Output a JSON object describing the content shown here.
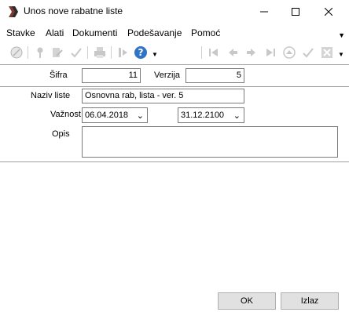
{
  "window": {
    "title": "Unos nove rabatne liste"
  },
  "menu": [
    "Stavke",
    "Alati",
    "Dokumenti",
    "Podešavanje",
    "Pomoć"
  ],
  "form": {
    "sifra_label": "Šifra",
    "sifra_value": "11",
    "verzija_label": "Verzija",
    "verzija_value": "5",
    "naziv_label": "Naziv liste",
    "naziv_value": "Osnovna rab, lista - ver. 5",
    "vaznost_label": "Važnost",
    "vaznost_from": "06.04.2018",
    "vaznost_to": "31.12.2100",
    "opis_label": "Opis",
    "opis_value": ""
  },
  "buttons": {
    "ok": "OK",
    "cancel": "Izlaz"
  }
}
